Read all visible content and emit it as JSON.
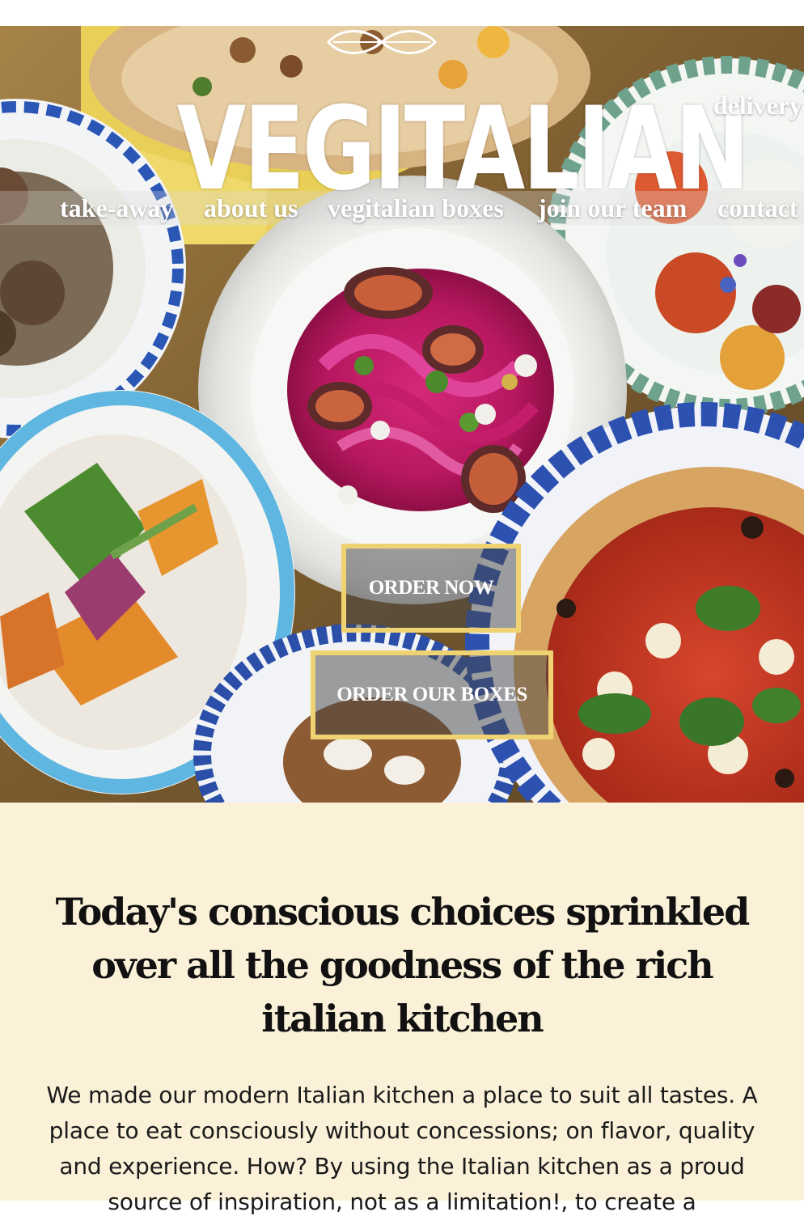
{
  "brand": {
    "logo_text": "VEGITALIAN"
  },
  "nav": {
    "delivery": "delivery",
    "items": [
      {
        "label": "take-away"
      },
      {
        "label": "about us"
      },
      {
        "label": "vegitalian boxes"
      },
      {
        "label": "join our team"
      },
      {
        "label": "contact"
      }
    ]
  },
  "hero": {
    "order_now": "ORDER NOW",
    "order_boxes": "ORDER OUR BOXES"
  },
  "intro": {
    "heading": "Today's conscious choices sprinkled over all the goodness of the rich italian kitchen",
    "body": "We made our modern Italian kitchen a place to suit all tastes. A place to eat consciously without concessions; on flavor, quality and experience. How? By using the Italian kitchen as a proud source of inspiration, not as a limitation!, to create a"
  },
  "colors": {
    "cta_border": "#efd372",
    "intro_background": "#fbf1d9",
    "heading_text": "#111111"
  },
  "icons": {
    "logo_ornament": "leaf-ornament-icon"
  }
}
